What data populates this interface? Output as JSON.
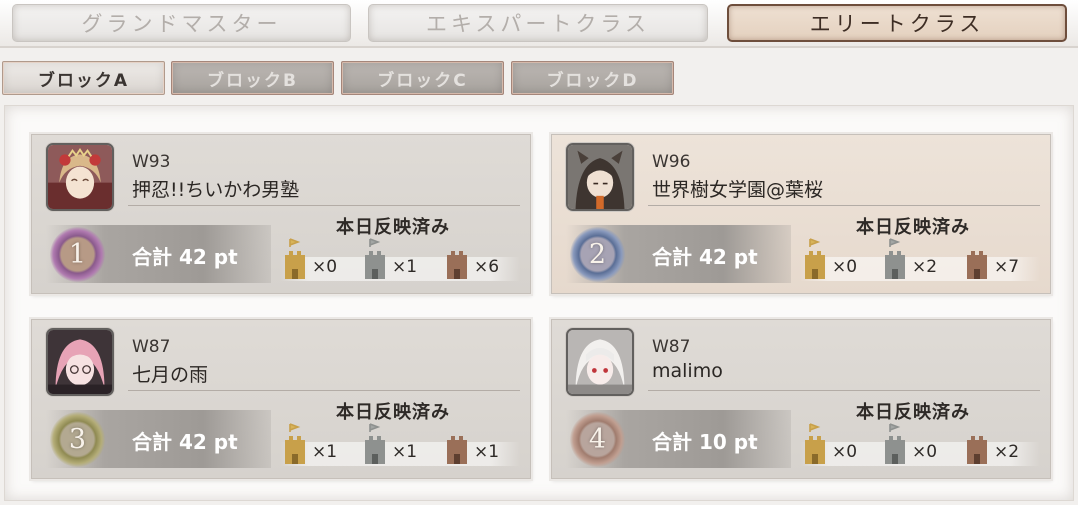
{
  "class_tabs": [
    {
      "label": "グランドマスター",
      "active": false
    },
    {
      "label": "エキスパートクラス",
      "active": false
    },
    {
      "label": "エリートクラス",
      "active": true
    }
  ],
  "block_tabs": [
    {
      "label": "ブロックA",
      "active": true
    },
    {
      "label": "ブロックB",
      "active": false
    },
    {
      "label": "ブロックC",
      "active": false
    },
    {
      "label": "ブロックD",
      "active": false
    }
  ],
  "status_label": "本日反映済み",
  "castle_icons": [
    "gold-castle-icon",
    "silver-castle-icon",
    "bronze-castle-icon"
  ],
  "colors": {
    "gold": "#c8a04a",
    "silver": "#8e918f",
    "bronze": "#9a6f58",
    "emblem_1": "#8a5a8c",
    "emblem_2": "#5a6e96",
    "emblem_3": "#8f8a52",
    "emblem_4": "#a07c6e"
  },
  "entries": [
    {
      "rank": "1",
      "world": "W93",
      "name": "押忍!!ちいかわ男塾",
      "total": "合計 42 pt",
      "gold": "×0",
      "silver": "×1",
      "bronze": "×6"
    },
    {
      "rank": "2",
      "world": "W96",
      "name": "世界樹女学園@葉桜",
      "total": "合計 42 pt",
      "gold": "×0",
      "silver": "×2",
      "bronze": "×7"
    },
    {
      "rank": "3",
      "world": "W87",
      "name": "七月の雨",
      "total": "合計 42 pt",
      "gold": "×1",
      "silver": "×1",
      "bronze": "×1"
    },
    {
      "rank": "4",
      "world": "W87",
      "name": "malimo",
      "total": "合計 10 pt",
      "gold": "×0",
      "silver": "×0",
      "bronze": "×2"
    }
  ]
}
